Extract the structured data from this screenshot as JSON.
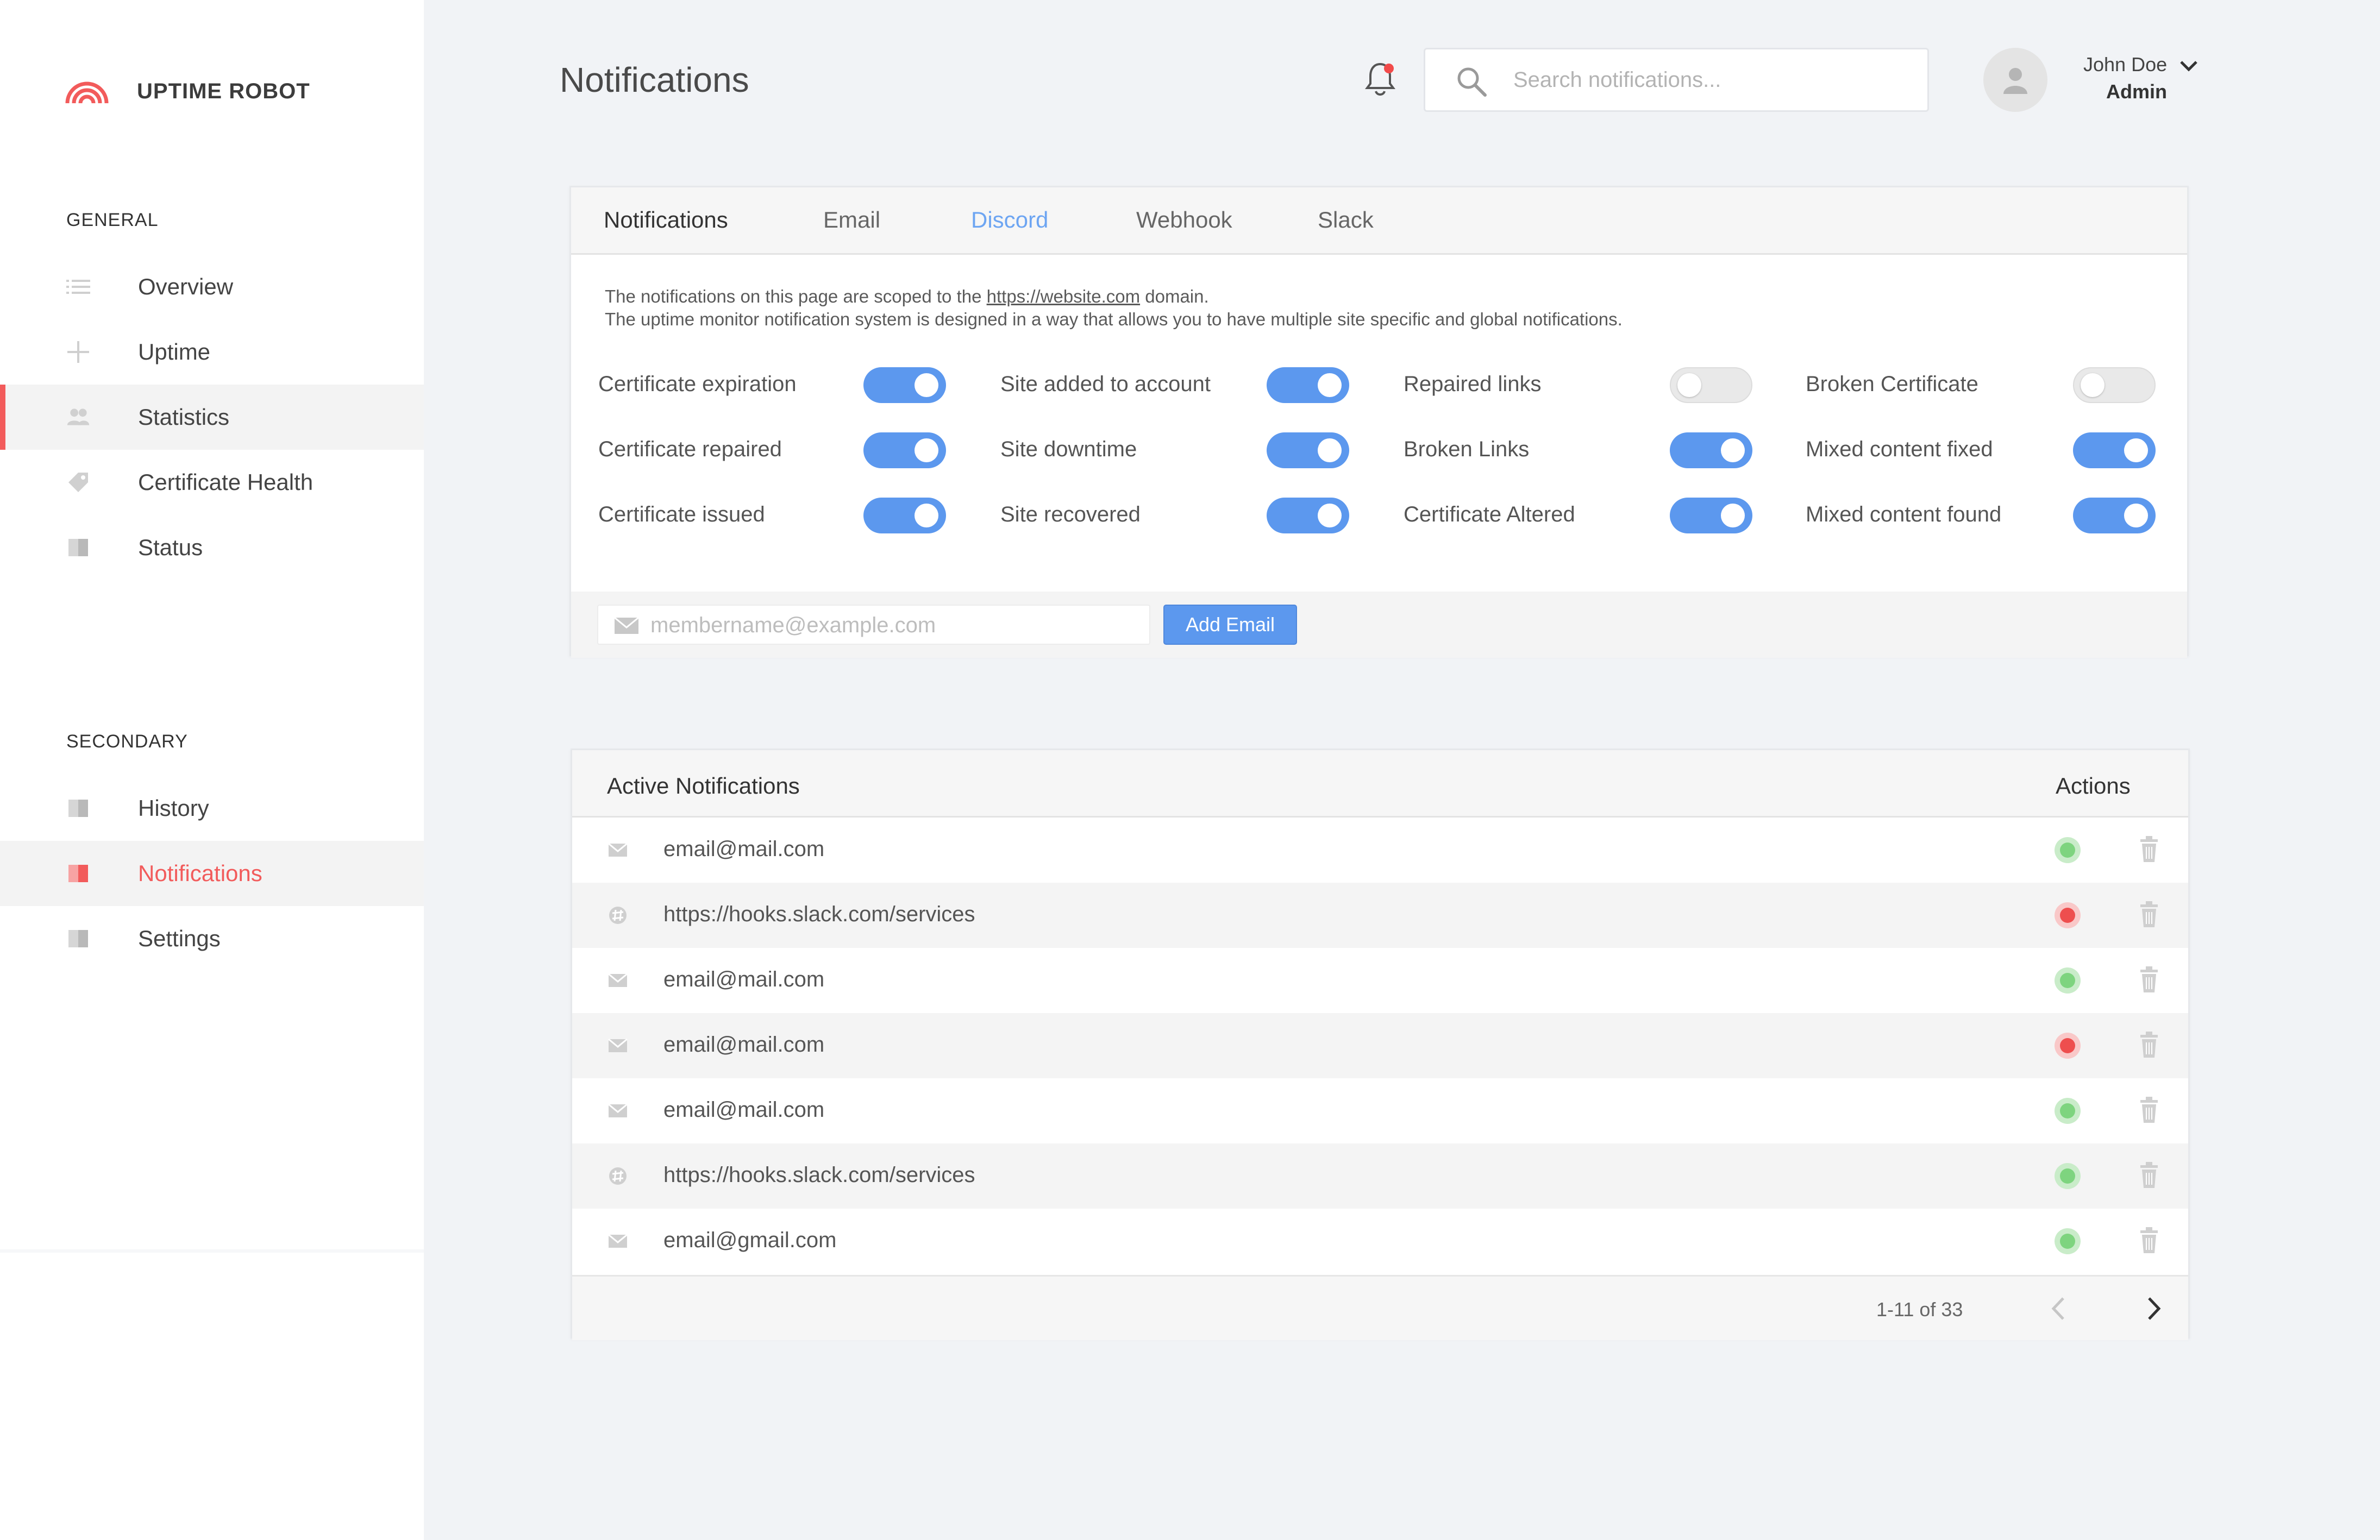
{
  "brand": {
    "name": "UPTIME ROBOT",
    "accent": "#f25b5b"
  },
  "sidebar": {
    "general_label": "GENERAL",
    "general_items": [
      {
        "label": "Overview",
        "icon": "list-icon"
      },
      {
        "label": "Uptime",
        "icon": "plus-icon"
      },
      {
        "label": "Statistics",
        "icon": "users-icon"
      },
      {
        "label": "Certificate Health",
        "icon": "tag-icon"
      },
      {
        "label": "Status",
        "icon": "book-icon"
      }
    ],
    "secondary_label": "SECONDARY",
    "secondary_items": [
      {
        "label": "History",
        "icon": "book-icon"
      },
      {
        "label": "Notifications",
        "icon": "book-icon"
      },
      {
        "label": "Settings",
        "icon": "book-icon"
      }
    ]
  },
  "header": {
    "title": "Notifications",
    "search_placeholder": "Search notifications...",
    "user_name": "John Doe",
    "user_role": "Admin"
  },
  "tabs": [
    "Notifications",
    "Email",
    "Discord",
    "Webhook",
    "Slack"
  ],
  "description": {
    "line1_before": "The notifications on this page are scoped to the ",
    "line1_link": "https://website.com",
    "line1_after": " domain.",
    "line2": "The uptime monitor notification system is designed in a way that allows you to have multiple site specific and global notifications."
  },
  "toggles": [
    {
      "label": "Certificate expiration",
      "on": true
    },
    {
      "label": "Site added to account",
      "on": true
    },
    {
      "label": "Repaired links",
      "on": false
    },
    {
      "label": "Broken Certificate",
      "on": false
    },
    {
      "label": "Certificate repaired",
      "on": true
    },
    {
      "label": "Site downtime",
      "on": true
    },
    {
      "label": "Broken Links",
      "on": true
    },
    {
      "label": "Mixed content fixed",
      "on": true
    },
    {
      "label": "Certificate issued",
      "on": true
    },
    {
      "label": "Site recovered",
      "on": true
    },
    {
      "label": "Certificate Altered",
      "on": true
    },
    {
      "label": "Mixed content found",
      "on": true
    }
  ],
  "email_form": {
    "placeholder": "membername@example.com",
    "button": "Add Email"
  },
  "table": {
    "title": "Active Notifications",
    "actions_label": "Actions",
    "rows": [
      {
        "type": "mail-icon",
        "target": "email@mail.com",
        "status": "ok"
      },
      {
        "type": "slack-icon",
        "target": "https://hooks.slack.com/services",
        "status": "err"
      },
      {
        "type": "mail-icon",
        "target": "email@mail.com",
        "status": "ok"
      },
      {
        "type": "mail-icon",
        "target": "email@mail.com",
        "status": "err"
      },
      {
        "type": "mail-icon",
        "target": "email@mail.com",
        "status": "ok"
      },
      {
        "type": "slack-icon",
        "target": "https://hooks.slack.com/services",
        "status": "ok"
      },
      {
        "type": "mail-icon",
        "target": "email@gmail.com",
        "status": "ok"
      }
    ],
    "pagination": "1-11 of 33"
  }
}
